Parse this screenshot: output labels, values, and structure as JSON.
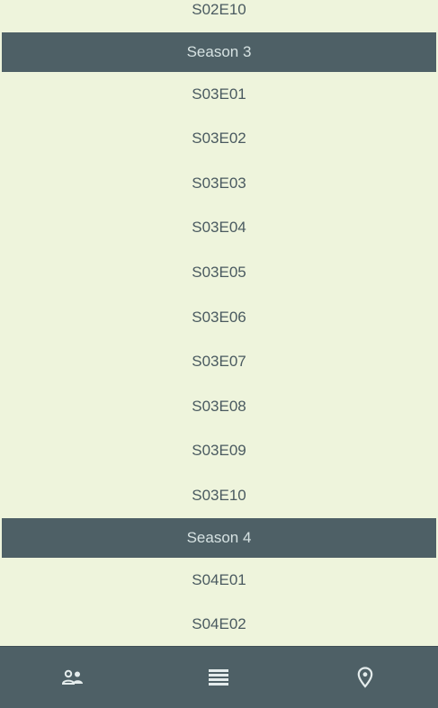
{
  "episodes_list": {
    "rows": [
      {
        "type": "episode",
        "label": "S02E10"
      },
      {
        "type": "season",
        "label": "Season 3"
      },
      {
        "type": "episode",
        "label": "S03E01"
      },
      {
        "type": "episode",
        "label": "S03E02"
      },
      {
        "type": "episode",
        "label": "S03E03"
      },
      {
        "type": "episode",
        "label": "S03E04"
      },
      {
        "type": "episode",
        "label": "S03E05"
      },
      {
        "type": "episode",
        "label": "S03E06"
      },
      {
        "type": "episode",
        "label": "S03E07"
      },
      {
        "type": "episode",
        "label": "S03E08"
      },
      {
        "type": "episode",
        "label": "S03E09"
      },
      {
        "type": "episode",
        "label": "S03E10"
      },
      {
        "type": "season",
        "label": "Season 4"
      },
      {
        "type": "episode",
        "label": "S04E01"
      },
      {
        "type": "episode",
        "label": "S04E02"
      }
    ]
  },
  "bottom_nav": {
    "items": [
      {
        "icon": "people-icon"
      },
      {
        "icon": "list-icon"
      },
      {
        "icon": "location-pin-icon"
      }
    ]
  },
  "colors": {
    "background": "#eef4dc",
    "season_header": "#4e6066",
    "nav_bar": "#4e6066",
    "icon": "#e4ecec"
  }
}
